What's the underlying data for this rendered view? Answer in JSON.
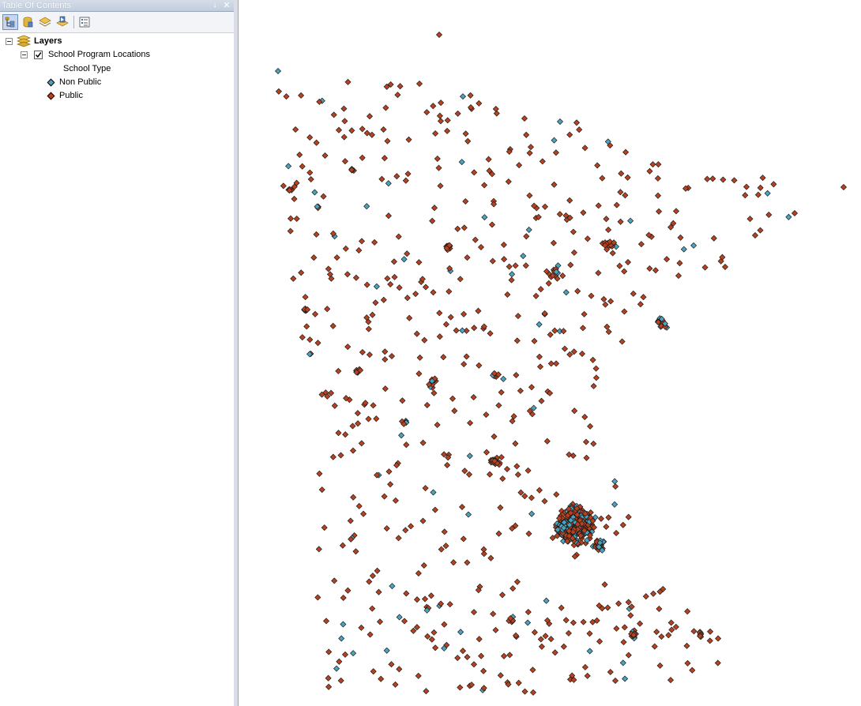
{
  "panel": {
    "title": "Table Of Contents",
    "pin_glyph": "↓",
    "close_glyph": "✕"
  },
  "toolbar": {
    "buttons": [
      {
        "name": "list-by-drawing-order-icon",
        "active": true
      },
      {
        "name": "list-by-source-icon",
        "active": false
      },
      {
        "name": "list-by-visibility-icon",
        "active": false
      },
      {
        "name": "list-by-selection-icon",
        "active": false
      },
      {
        "name": "options-icon",
        "active": false
      }
    ]
  },
  "tree": {
    "root_label": "Layers",
    "layer_label": "School Program Locations",
    "layer_checked": true,
    "field_label": "School Type",
    "classes": [
      {
        "label": "Non Public",
        "color": "#4ba3bf"
      },
      {
        "label": "Public",
        "color": "#b8421f"
      }
    ]
  },
  "colors": {
    "non_public": "#4ba3bf",
    "public": "#b8421f",
    "outline": "#1a1a1a",
    "panel_border": "#9aa7b8"
  },
  "map": {
    "layer_name": "School Program Locations"
  }
}
